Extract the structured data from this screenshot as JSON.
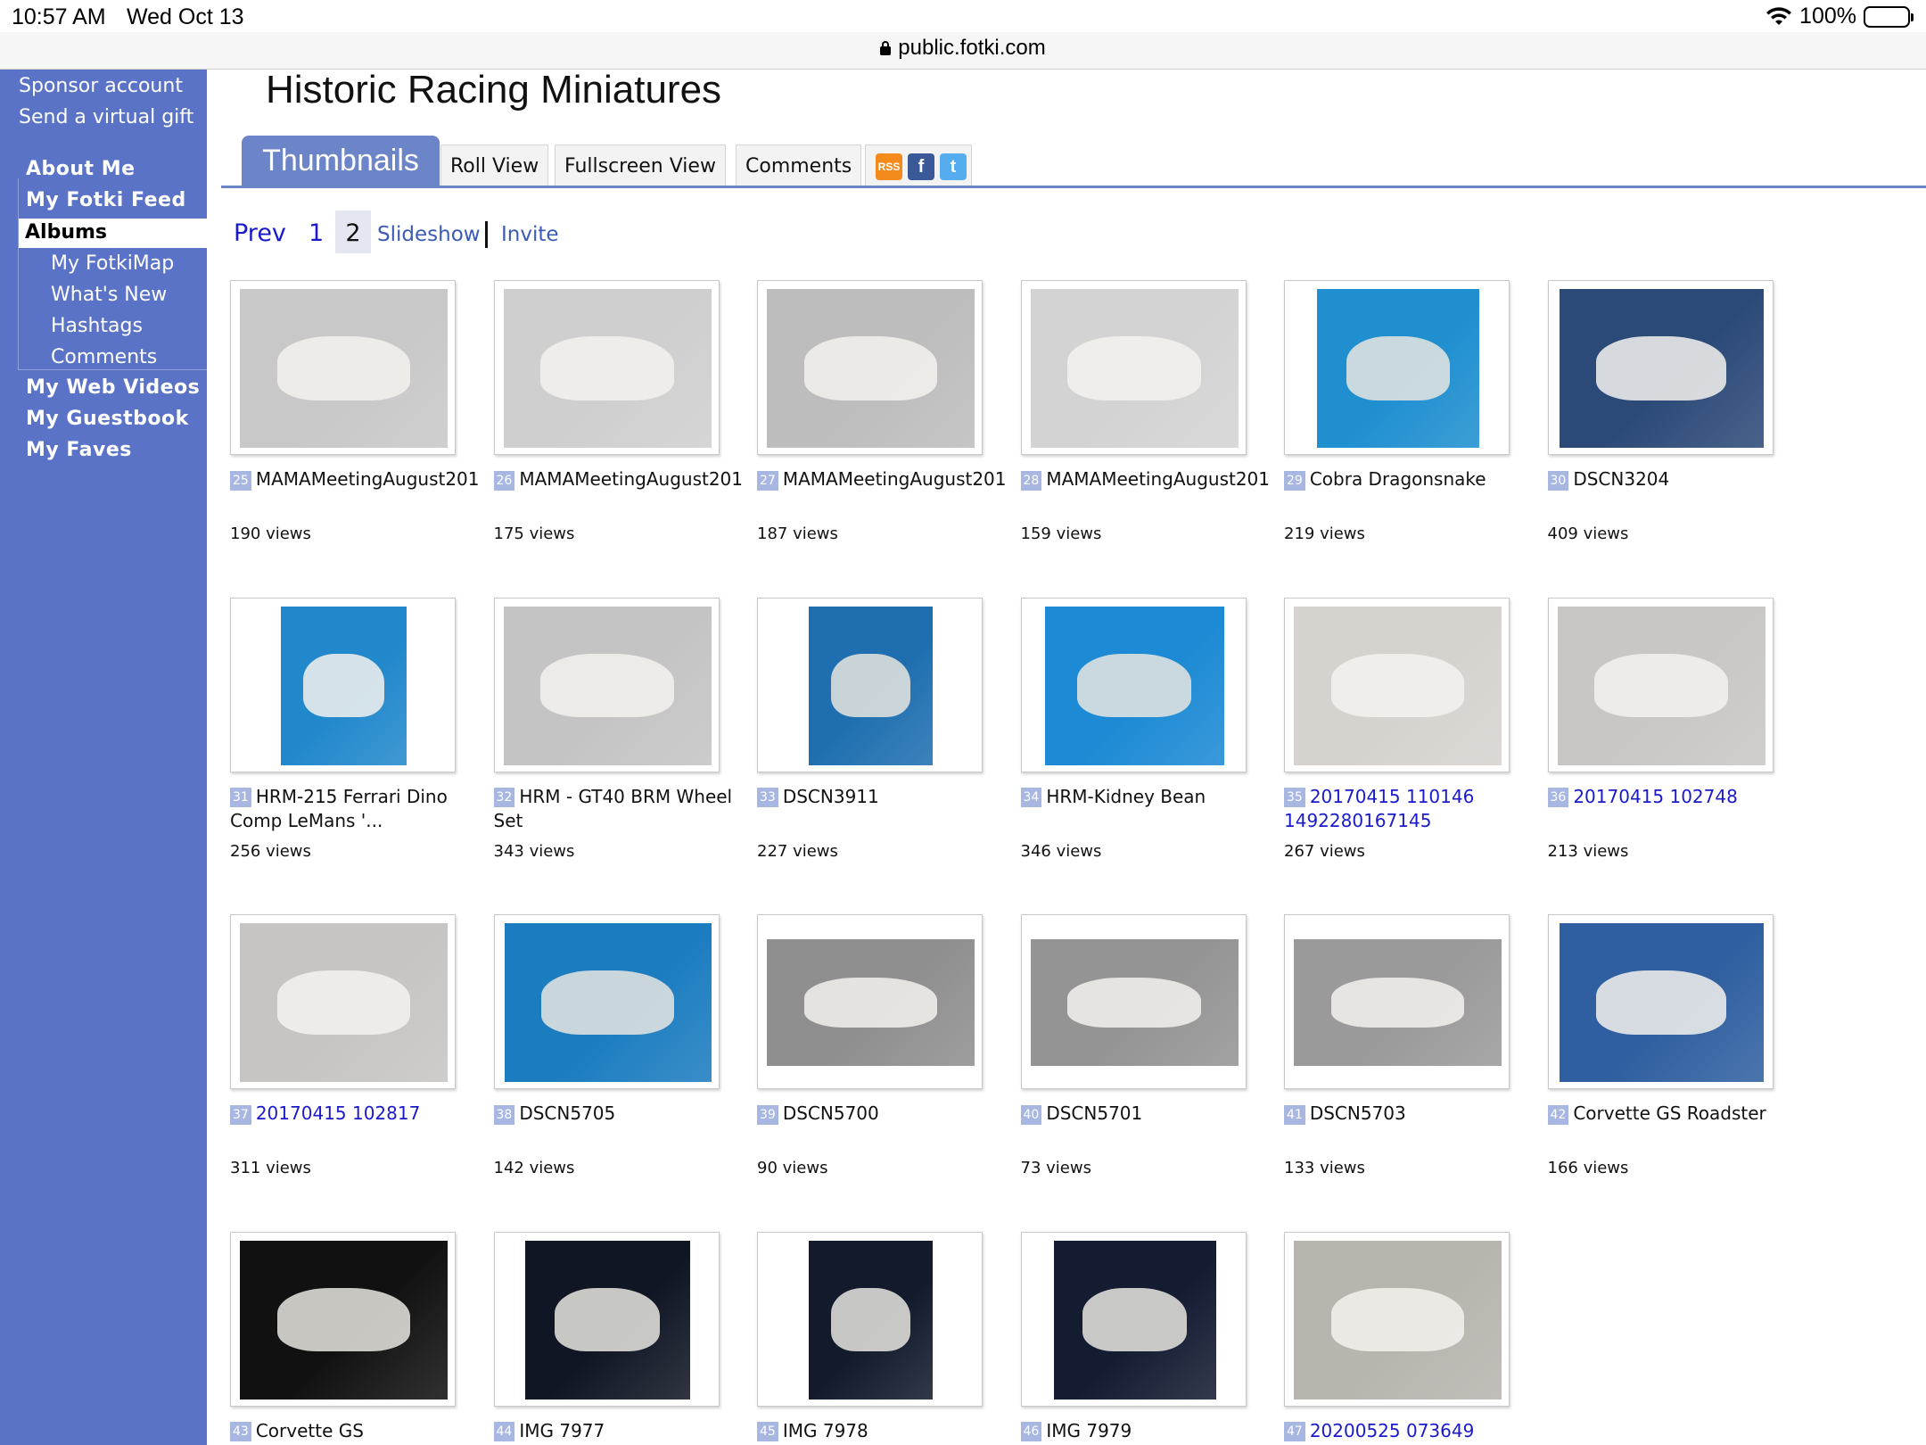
{
  "status_bar": {
    "time": "10:57 AM",
    "date": "Wed Oct 13",
    "battery": "100%"
  },
  "browser": {
    "url": "public.fotki.com"
  },
  "sidebar": {
    "top_links": [
      "Sponsor account",
      "Send a virtual gift"
    ],
    "nav": {
      "about_me": "About Me",
      "feed": "My Fotki Feed",
      "albums": "Albums",
      "sub": [
        "My FotkiMap",
        "What's New",
        "Hashtags",
        "Comments"
      ],
      "web_videos": "My Web Videos",
      "guestbook": "My Guestbook",
      "faves": "My Faves"
    }
  },
  "page": {
    "title": "Historic Racing Miniatures"
  },
  "tabs": {
    "active": "Thumbnails",
    "items": [
      "Roll View",
      "Fullscreen View",
      "Comments"
    ]
  },
  "social": {
    "rss": "RSS",
    "facebook": "f",
    "twitter": "t"
  },
  "pager": {
    "prev": "Prev",
    "page1": "1",
    "current": "2",
    "slideshow": "Slideshow",
    "invite": "Invite"
  },
  "photos": [
    {
      "num": "25",
      "title": "MAMAMeetingAugust201",
      "views": "190 views",
      "tone": "#c8c8c8",
      "link": false
    },
    {
      "num": "26",
      "title": "MAMAMeetingAugust201",
      "views": "175 views",
      "tone": "#cfcfcf",
      "link": false
    },
    {
      "num": "27",
      "title": "MAMAMeetingAugust201",
      "views": "187 views",
      "tone": "#bdbdbd",
      "link": false
    },
    {
      "num": "28",
      "title": "MAMAMeetingAugust201",
      "views": "159 views",
      "tone": "#d3d3d3",
      "link": false
    },
    {
      "num": "29",
      "title": "Cobra Dragonsnake",
      "views": "219 views",
      "tone": "#1f8fd0",
      "link": false
    },
    {
      "num": "30",
      "title": "DSCN3204",
      "views": "409 views",
      "tone": "#2c4a78",
      "link": false
    },
    {
      "num": "31",
      "title": "HRM-215 Ferrari Dino Comp   LeMans '...",
      "views": "256 views",
      "tone": "#2288cc",
      "link": false
    },
    {
      "num": "32",
      "title": "HRM - GT40 BRM Wheel Set",
      "views": "343 views",
      "tone": "#c4c4c4",
      "link": false
    },
    {
      "num": "33",
      "title": "DSCN3911",
      "views": "227 views",
      "tone": "#1f6fb0",
      "link": false
    },
    {
      "num": "34",
      "title": "HRM-Kidney Bean",
      "views": "346 views",
      "tone": "#1c8ad4",
      "link": false
    },
    {
      "num": "35",
      "title": "20170415 110146 1492280167145",
      "views": "267 views",
      "tone": "#d6d2ce",
      "link": true
    },
    {
      "num": "36",
      "title": "20170415 102748",
      "views": "213 views",
      "tone": "#c9c7c5",
      "link": true
    },
    {
      "num": "37",
      "title": "20170415 102817",
      "views": "311 views",
      "tone": "#c7c5c3",
      "link": true
    },
    {
      "num": "38",
      "title": "DSCN5705",
      "views": "142 views",
      "tone": "#1b7cc0",
      "link": false
    },
    {
      "num": "39",
      "title": "DSCN5700",
      "views": "90 views",
      "tone": "#8f8f8f",
      "link": false
    },
    {
      "num": "40",
      "title": "DSCN5701",
      "views": "73 views",
      "tone": "#949494",
      "link": false
    },
    {
      "num": "41",
      "title": "DSCN5703",
      "views": "133 views",
      "tone": "#9a9a9a",
      "link": false
    },
    {
      "num": "42",
      "title": "Corvette GS Roadster",
      "views": "166 views",
      "tone": "#2f5fa0",
      "link": false
    },
    {
      "num": "43",
      "title": "Corvette GS",
      "views": "",
      "tone": "#111111",
      "link": false
    },
    {
      "num": "44",
      "title": "IMG 7977",
      "views": "",
      "tone": "#101624",
      "link": false
    },
    {
      "num": "45",
      "title": "IMG 7978",
      "views": "",
      "tone": "#121a2c",
      "link": false
    },
    {
      "num": "46",
      "title": "IMG 7979",
      "views": "",
      "tone": "#141c32",
      "link": false
    },
    {
      "num": "47",
      "title": "20200525 073649",
      "views": "",
      "tone": "#b8b4ae",
      "link": true
    }
  ]
}
